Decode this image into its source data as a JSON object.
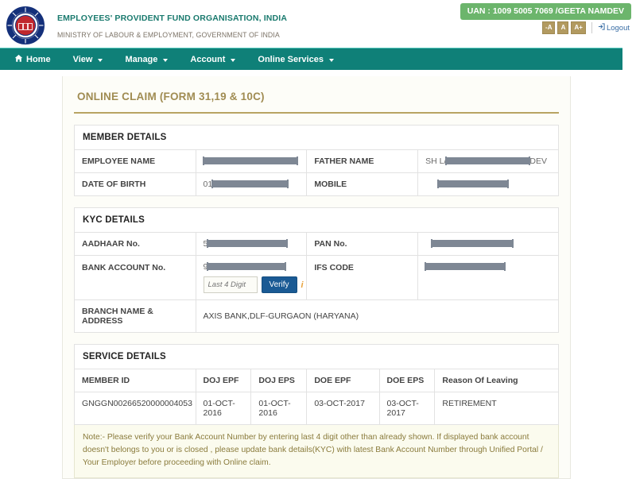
{
  "header": {
    "logo_icon": "epfo-emblem-icon",
    "org_title": "EMPLOYEES' PROVIDENT FUND ORGANISATION, INDIA",
    "org_subtitle": "MINISTRY OF LABOUR & EMPLOYMENT, GOVERNMENT OF INDIA",
    "uan_badge": "UAN : 1009 5005 7069 /GEETA NAMDEV",
    "font_decrease": "-A",
    "font_normal": "A",
    "font_increase": "A+",
    "logout": "Logout",
    "logout_icon": "logout-icon",
    "colors": {
      "uan_badge_bg": "#6cb56c",
      "org_title": "#1a7a6e",
      "fs_button_bg": "#b29a60",
      "logout_link": "#3a6ea5"
    }
  },
  "nav": {
    "items": [
      {
        "label": "Home",
        "icon": "home-icon",
        "caret": false
      },
      {
        "label": "View",
        "icon": "",
        "caret": true
      },
      {
        "label": "Manage",
        "icon": "",
        "caret": true
      },
      {
        "label": "Account",
        "icon": "",
        "caret": true
      },
      {
        "label": "Online Services",
        "icon": "",
        "caret": true
      }
    ],
    "bg_color": "#0f8078"
  },
  "page": {
    "title": "ONLINE CLAIM (FORM 31,19 & 10C)",
    "title_color": "#a08c52"
  },
  "member_details": {
    "heading": "MEMBER DETAILS",
    "rows": [
      {
        "label_left": "EMPLOYEE NAME",
        "value_left_prefix": "",
        "value_left_redacted_width": 118,
        "value_left_suffix": "",
        "label_right": "FATHER NAME",
        "value_right_prefix": "SH L/",
        "value_right_redacted_width": 105,
        "value_right_suffix": "DEV"
      },
      {
        "label_left": "DATE OF BIRTH",
        "value_left_prefix": "01",
        "value_left_redacted_width": 95,
        "value_left_suffix": "",
        "label_right": "MOBILE",
        "value_right_prefix": "",
        "value_right_redacted_width": 88,
        "value_right_suffix": ""
      }
    ]
  },
  "kyc_details": {
    "heading": "KYC DETAILS",
    "rows": [
      {
        "label_left": "AADHAAR No.",
        "value_left_prefix": "5",
        "value_left_redacted_width": 100,
        "label_right": "PAN No.",
        "value_right_prefix": "",
        "value_right_redacted_width": 102
      },
      {
        "label_left": "BANK ACCOUNT No.",
        "value_left_prefix": "9",
        "value_left_redacted_width": 98,
        "label_right": "IFS CODE",
        "value_right_prefix": "",
        "value_right_redacted_width": 100
      }
    ],
    "last4_placeholder": "Last 4 Digit",
    "last4_value": "",
    "verify_label": "Verify",
    "info_icon": "info-icon",
    "branch_label": "BRANCH NAME & ADDRESS",
    "branch_value": "AXIS BANK,DLF-GURGAON (HARYANA)",
    "verify_button_color": "#1a5a94"
  },
  "service_details": {
    "heading": "SERVICE DETAILS",
    "columns": [
      "MEMBER ID",
      "DOJ EPF",
      "DOJ EPS",
      "DOE EPF",
      "DOE EPS",
      "Reason Of Leaving"
    ],
    "rows": [
      {
        "member_id": "GNGGN00266520000004053",
        "doj_epf": "01-OCT-2016",
        "doj_eps": "01-OCT-2016",
        "doe_epf": "03-OCT-2017",
        "doe_eps": "03-OCT-2017",
        "reason": "RETIREMENT"
      }
    ]
  },
  "note": {
    "text": "Note:- Please verify your Bank Account Number by entering last 4 digit other than already shown. If displayed bank account doesn't belongs to you or is closed , please update bank details(KYC) with latest Bank Account Number through Unified Portal / Your Employer before proceeding with Online claim."
  }
}
